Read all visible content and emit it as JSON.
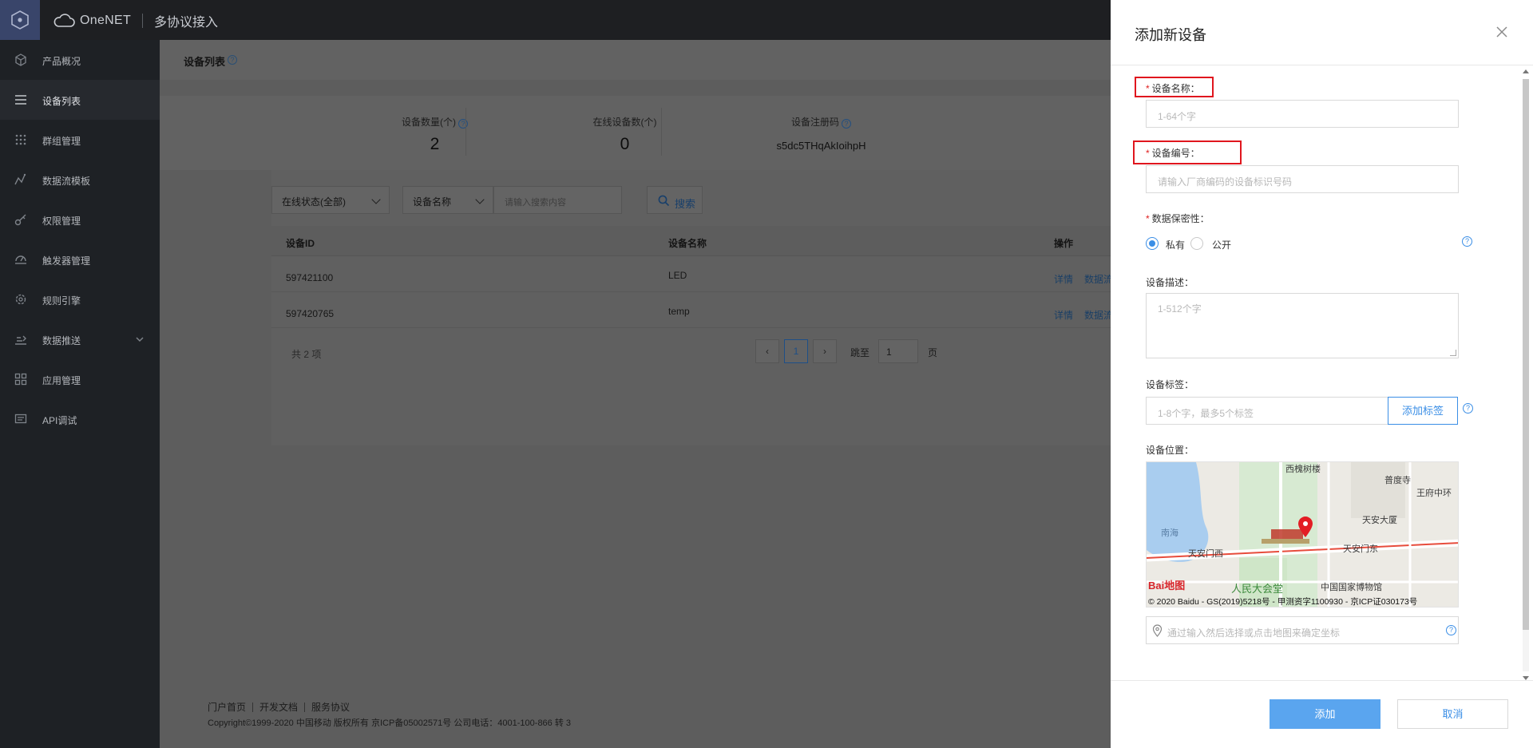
{
  "topbar": {
    "brand": "OneNET",
    "module": "多协议接入"
  },
  "sidebar": {
    "items": [
      {
        "label": "产品概况",
        "icon": "cube-icon"
      },
      {
        "label": "设备列表",
        "icon": "list-icon",
        "active": true
      },
      {
        "label": "群组管理",
        "icon": "grid-dots-icon"
      },
      {
        "label": "数据流模板",
        "icon": "wave-icon"
      },
      {
        "label": "权限管理",
        "icon": "key-icon"
      },
      {
        "label": "触发器管理",
        "icon": "trigger-icon"
      },
      {
        "label": "规则引擎",
        "icon": "gear-icon"
      },
      {
        "label": "数据推送",
        "icon": "push-icon",
        "expandable": true
      },
      {
        "label": "应用管理",
        "icon": "apps-icon"
      },
      {
        "label": "API调试",
        "icon": "api-icon"
      }
    ]
  },
  "main": {
    "breadcrumb": "设备列表",
    "stats": [
      {
        "label": "设备数量(个)",
        "value": "2",
        "help": true
      },
      {
        "label": "在线设备数(个)",
        "value": "0",
        "help": false
      },
      {
        "label": "设备注册码",
        "value": "s5dc5THqAkIoihpH",
        "help": true
      }
    ],
    "filters": {
      "status": "在线状态(全部)",
      "field": "设备名称",
      "search_placeholder": "请输入搜索内容",
      "search_button": "搜索"
    },
    "table": {
      "columns": [
        "设备ID",
        "设备名称",
        "操作"
      ],
      "rows": [
        {
          "id": "597421100",
          "name": "LED",
          "actions": [
            "详情",
            "数据流"
          ]
        },
        {
          "id": "597420765",
          "name": "temp",
          "actions": [
            "详情",
            "数据流"
          ]
        }
      ]
    },
    "pager": {
      "total": "共 2 项",
      "current": "1",
      "jump_label": "跳至",
      "jump_value": "1",
      "page_unit": "页"
    }
  },
  "footer": {
    "links": [
      "门户首页",
      "开发文档",
      "服务协议"
    ],
    "copyright": "Copyright©1999-2020 中国移动 版权所有 京ICP备05002571号 公司电话：4001-100-866 转 3"
  },
  "drawer": {
    "title": "添加新设备",
    "name_label": "设备名称：",
    "name_placeholder": "1-64个字",
    "sn_label": "设备编号：",
    "sn_placeholder": "请输入厂商编码的设备标识号码",
    "privacy_label": "数据保密性：",
    "privacy_private": "私有",
    "privacy_public": "公开",
    "privacy_selected": "私有",
    "desc_label": "设备描述：",
    "desc_placeholder": "1-512个字",
    "tag_label": "设备标签：",
    "tag_placeholder": "1-8个字，最多5个标签",
    "tag_button": "添加标签",
    "location_label": "设备位置：",
    "location_placeholder": "通过输入然后选择或点击地图来确定坐标",
    "map": {
      "labels": [
        "西槐树楼",
        "普度寺",
        "王府中环",
        "天安大厦",
        "南海",
        "天安门西",
        "天安门东",
        "中国国家博物馆",
        "人民大会堂"
      ],
      "logo": "Bai地图",
      "copyright": "© 2020 Baidu - GS(2019)5218号 - 甲测资字1100930 - 京ICP证030173号"
    },
    "add_button": "添加",
    "cancel_button": "取消"
  },
  "colors": {
    "accent": "#3a8ee6",
    "primary_button": "#5aa5ef",
    "highlight_box": "#e0161e",
    "required": "#e02020"
  }
}
